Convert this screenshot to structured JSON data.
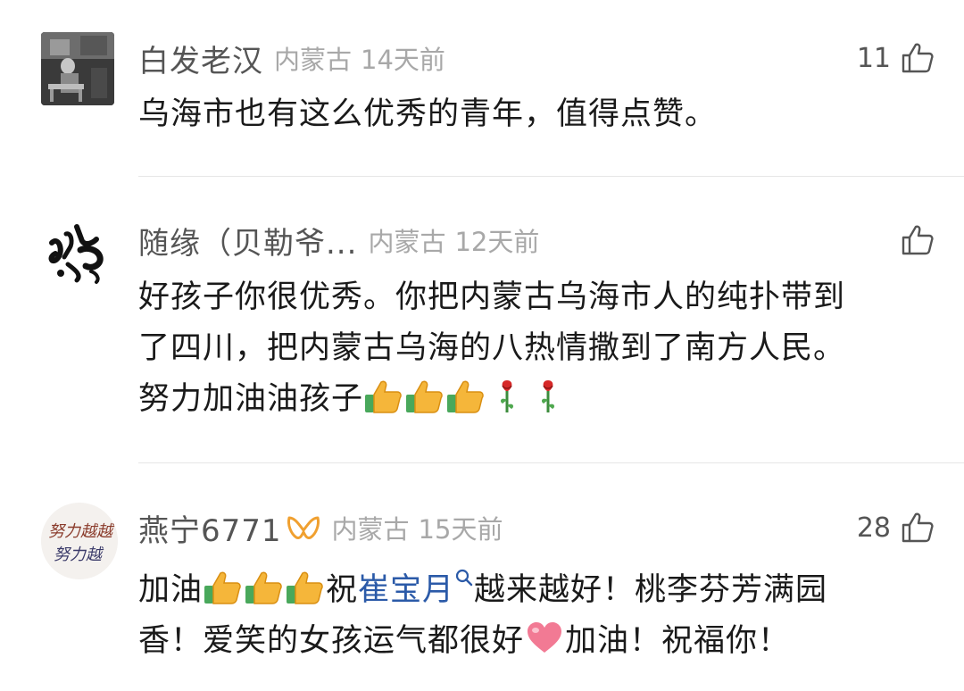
{
  "comments": [
    {
      "username": "白发老汉",
      "location": "内蒙古",
      "time": "14天前",
      "likes": "11",
      "text": "乌海市也有这么优秀的青年，值得点赞。"
    },
    {
      "username": "随缘（贝勒爷...",
      "location": "内蒙古",
      "time": "12天前",
      "likes": "",
      "text_line1": "好孩子你很优秀。你把内蒙古乌海市人的纯扑带到",
      "text_line2": "了四川，把内蒙古乌海的八热情撒到了南方人民。",
      "text_line3": "努力加油油孩子"
    },
    {
      "username": "燕宁6771",
      "location": "内蒙古",
      "time": "15天前",
      "likes": "28",
      "text_a": "加油",
      "text_b": "祝",
      "mention": "崔宝月",
      "text_c": "越来越好！桃李芬芳满园",
      "text_d": "香！爱笑的女孩运气都很好",
      "text_e": "加油！祝福你！",
      "avatar_text": "努力越越",
      "avatar_text2": "努力越"
    }
  ],
  "icons": {
    "like": "thumbs-up-outline-icon",
    "thumbs_emoji": "thumbs-up-emoji",
    "rose_emoji": "rose-emoji",
    "heart_emoji": "heart-emoji",
    "vip": "vip-badge-icon",
    "search": "search-mention-icon"
  },
  "colors": {
    "username": "#555555",
    "meta": "#a8a8a8",
    "text": "#1a1a1a",
    "mention": "#2b5aa8",
    "vip": "#f0a030",
    "divider": "#e6e6e6"
  }
}
